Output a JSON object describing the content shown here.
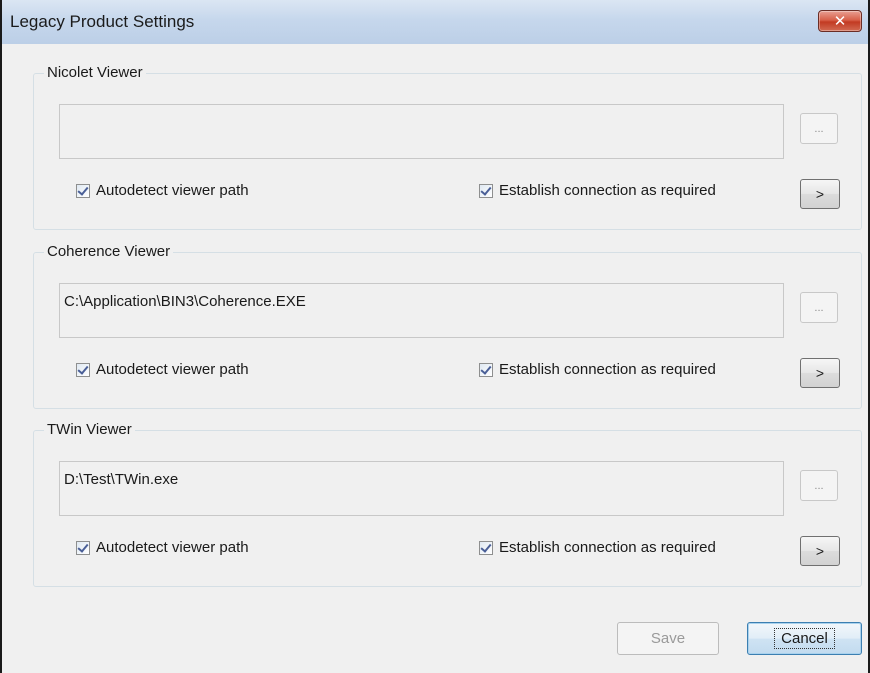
{
  "window": {
    "title": "Legacy Product Settings",
    "close_label": "✕"
  },
  "groups": [
    {
      "title": "Nicolet Viewer",
      "path": "",
      "browse_label": "...",
      "autodetect_label": "Autodetect viewer path",
      "autodetect_checked": true,
      "connection_label": "Establish connection as required",
      "connection_checked": true,
      "go_label": ">"
    },
    {
      "title": "Coherence Viewer",
      "path": "C:\\Application\\BIN3\\Coherence.EXE",
      "browse_label": "...",
      "autodetect_label": "Autodetect viewer path",
      "autodetect_checked": true,
      "connection_label": "Establish connection as required",
      "connection_checked": true,
      "go_label": ">"
    },
    {
      "title": "TWin Viewer",
      "path": "D:\\Test\\TWin.exe",
      "browse_label": "...",
      "autodetect_label": "Autodetect viewer path",
      "autodetect_checked": true,
      "connection_label": "Establish connection as required",
      "connection_checked": true,
      "go_label": ">"
    }
  ],
  "footer": {
    "save_label": "Save",
    "cancel_label": "Cancel"
  },
  "colors": {
    "titlebar": "#c6d7ec",
    "close_button": "#c23a22",
    "dialog_background": "#f0f0f0",
    "default_button_border": "#3c7fb1"
  }
}
